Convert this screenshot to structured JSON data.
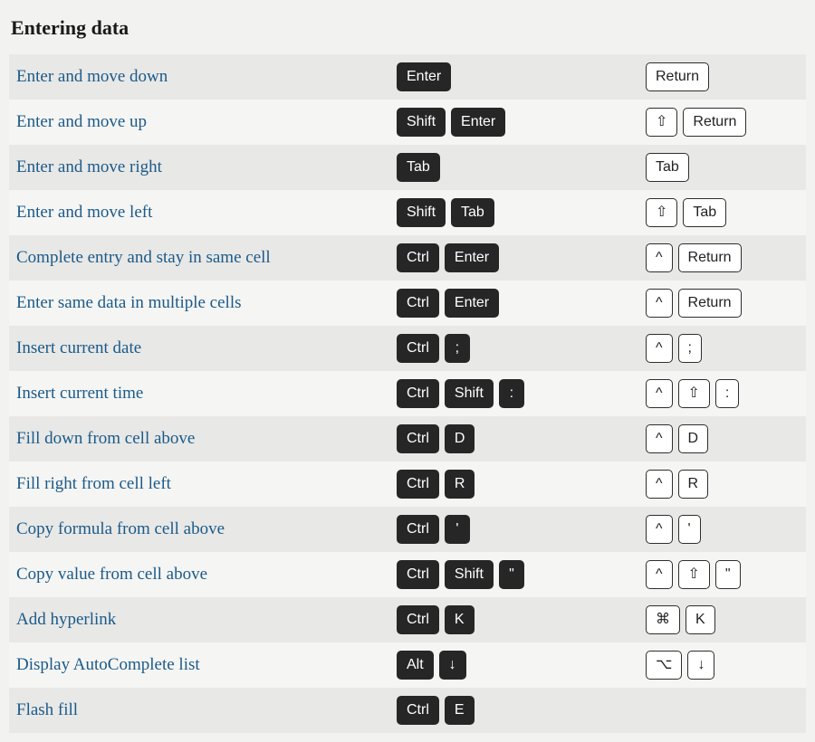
{
  "section_title": "Entering data",
  "shortcuts": [
    {
      "action": "Enter and move down",
      "win": [
        "Enter"
      ],
      "mac": [
        "Return"
      ]
    },
    {
      "action": "Enter and move up",
      "win": [
        "Shift",
        "Enter"
      ],
      "mac": [
        "⇧",
        "Return"
      ]
    },
    {
      "action": "Enter and move right",
      "win": [
        "Tab"
      ],
      "mac": [
        "Tab"
      ]
    },
    {
      "action": "Enter and move left",
      "win": [
        "Shift",
        "Tab"
      ],
      "mac": [
        "⇧",
        "Tab"
      ]
    },
    {
      "action": "Complete entry and stay in same cell",
      "win": [
        "Ctrl",
        "Enter"
      ],
      "mac": [
        "^",
        "Return"
      ]
    },
    {
      "action": "Enter same data in multiple cells",
      "win": [
        "Ctrl",
        "Enter"
      ],
      "mac": [
        "^",
        "Return"
      ]
    },
    {
      "action": "Insert current date",
      "win": [
        "Ctrl",
        ";"
      ],
      "mac": [
        "^",
        ";"
      ]
    },
    {
      "action": "Insert current time",
      "win": [
        "Ctrl",
        "Shift",
        ":"
      ],
      "mac": [
        "^",
        "⇧",
        ":"
      ]
    },
    {
      "action": "Fill down from cell above",
      "win": [
        "Ctrl",
        "D"
      ],
      "mac": [
        "^",
        "D"
      ]
    },
    {
      "action": "Fill right from cell left",
      "win": [
        "Ctrl",
        "R"
      ],
      "mac": [
        "^",
        "R"
      ]
    },
    {
      "action": "Copy formula from cell above",
      "win": [
        "Ctrl",
        "'"
      ],
      "mac": [
        "^",
        "'"
      ]
    },
    {
      "action": "Copy value from cell above",
      "win": [
        "Ctrl",
        "Shift",
        "\""
      ],
      "mac": [
        "^",
        "⇧",
        "\""
      ]
    },
    {
      "action": "Add hyperlink",
      "win": [
        "Ctrl",
        "K"
      ],
      "mac": [
        "⌘",
        "K"
      ]
    },
    {
      "action": "Display AutoComplete list",
      "win": [
        "Alt",
        "↓"
      ],
      "mac": [
        "⌥",
        "↓"
      ]
    },
    {
      "action": "Flash fill",
      "win": [
        "Ctrl",
        "E"
      ],
      "mac": []
    }
  ]
}
